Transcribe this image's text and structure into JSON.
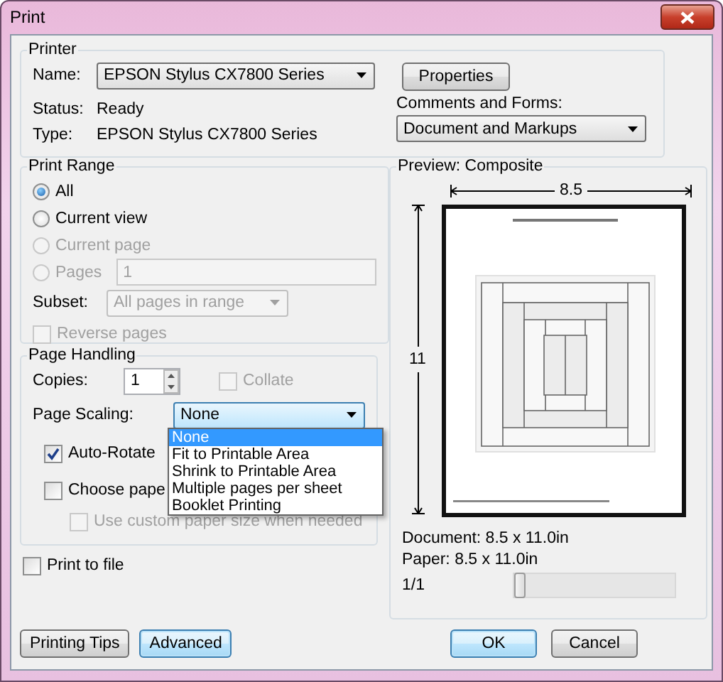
{
  "window": {
    "title": "Print"
  },
  "printer": {
    "title": "Printer",
    "name_label": "Name:",
    "name_value": "EPSON Stylus CX7800 Series",
    "status_label": "Status:",
    "status_value": "Ready",
    "type_label": "Type:",
    "type_value": "EPSON Stylus CX7800 Series",
    "properties_button": "Properties",
    "comments_label": "Comments and Forms:",
    "comments_value": "Document and Markups"
  },
  "print_range": {
    "title": "Print Range",
    "options": [
      {
        "label": "All",
        "selected": true,
        "disabled": false
      },
      {
        "label": "Current view",
        "selected": false,
        "disabled": false
      },
      {
        "label": "Current page",
        "selected": false,
        "disabled": true
      },
      {
        "label": "Pages",
        "selected": false,
        "disabled": true
      }
    ],
    "pages_value": "1",
    "subset_label": "Subset:",
    "subset_value": "All pages in range",
    "reverse": {
      "label": "Reverse pages",
      "checked": false,
      "disabled": true
    }
  },
  "page_handling": {
    "title": "Page Handling",
    "copies_label": "Copies:",
    "copies_value": "1",
    "collate": {
      "label": "Collate",
      "checked": false,
      "disabled": true
    },
    "scaling_label": "Page Scaling:",
    "scaling_value": "None",
    "scaling_options": [
      {
        "label": "None",
        "selected": true
      },
      {
        "label": "Fit to Printable Area",
        "selected": false
      },
      {
        "label": "Shrink to Printable Area",
        "selected": false
      },
      {
        "label": "Multiple pages per sheet",
        "selected": false
      },
      {
        "label": "Booklet Printing",
        "selected": false
      }
    ],
    "auto_rotate": {
      "label": "Auto-Rotate",
      "checked": true,
      "disabled": false
    },
    "choose_paper": {
      "label": "Choose pape",
      "checked": false,
      "disabled": false
    },
    "custom_paper": {
      "label": "Use custom paper size when needed",
      "checked": false,
      "disabled": true
    }
  },
  "print_to_file": {
    "label": "Print to file",
    "checked": false,
    "disabled": false
  },
  "preview": {
    "title": "Preview: Composite",
    "width_label": "8.5",
    "height_label": "11",
    "document": "Document: 8.5 x 11.0in",
    "paper": "Paper: 8.5 x 11.0in",
    "page_counter": "1/1",
    "page_slider": {
      "level": 0
    }
  },
  "left_buttons": [
    {
      "label": "Printing Tips",
      "default": false
    },
    {
      "label": "Advanced",
      "default": true
    }
  ],
  "right_buttons": [
    {
      "label": "OK",
      "default": true
    },
    {
      "label": "Cancel",
      "default": false
    }
  ]
}
